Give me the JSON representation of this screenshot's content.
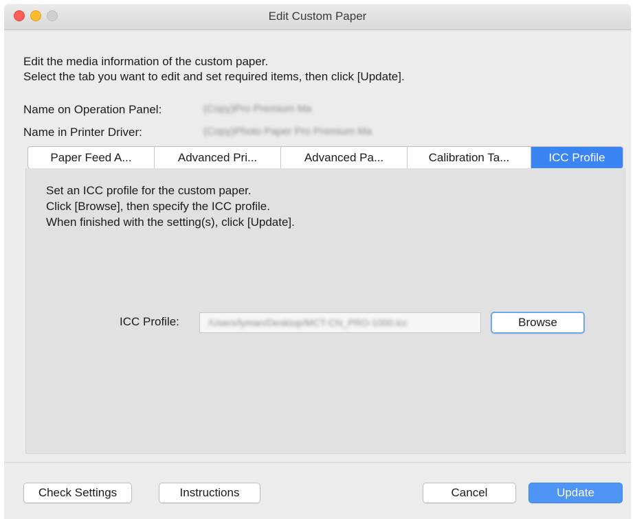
{
  "window": {
    "title": "Edit Custom Paper"
  },
  "intro": {
    "line1": "Edit the media information of the custom paper.",
    "line2": "Select the tab you want to edit and set required items, then click [Update]."
  },
  "names": {
    "operation_panel_label": "Name on Operation Panel:",
    "operation_panel_value": "(Copy)Pro Premium Ma",
    "printer_driver_label": "Name in Printer Driver:",
    "printer_driver_value": "(Copy)Photo Paper Pro Premium Ma"
  },
  "tabs": [
    {
      "label": "Paper Feed A...",
      "active": false
    },
    {
      "label": "Advanced Pri...",
      "active": false
    },
    {
      "label": "Advanced Pa...",
      "active": false
    },
    {
      "label": "Calibration Ta...",
      "active": false
    },
    {
      "label": "ICC Profile",
      "active": true
    }
  ],
  "panel": {
    "line1": "Set an ICC profile for the custom paper.",
    "line2": "Click [Browse], then specify the ICC profile.",
    "line3": "When finished with the setting(s), click [Update].",
    "icc_label": "ICC Profile:",
    "icc_value": "/Users/lyman/Desktop/MCT-CN_PRO-1000.icc",
    "browse_label": "Browse"
  },
  "footer": {
    "check_settings_label": "Check Settings",
    "instructions_label": "Instructions",
    "cancel_label": "Cancel",
    "update_label": "Update"
  },
  "colors": {
    "accent": "#3a84f3",
    "update_button": "#4f95f5",
    "close_light": "#fc5f57",
    "minimize_light": "#fdbc2e"
  }
}
